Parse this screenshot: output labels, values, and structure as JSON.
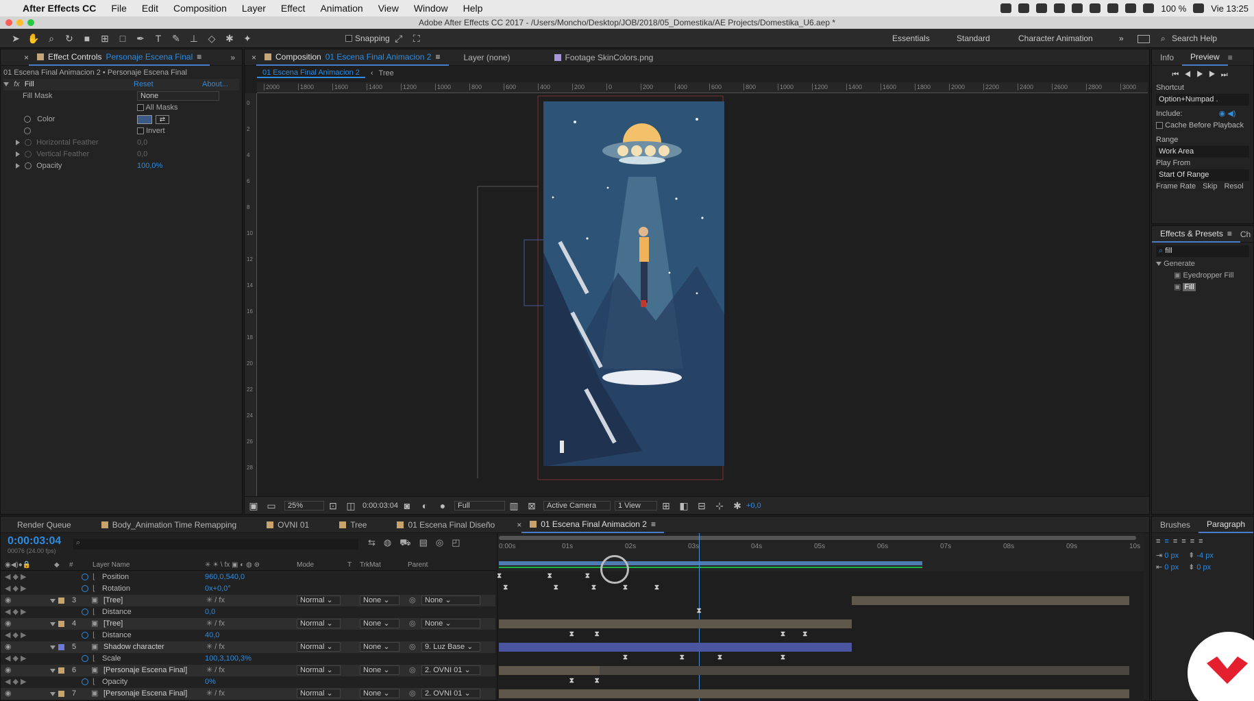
{
  "menubar": {
    "app": "After Effects CC",
    "items": [
      "File",
      "Edit",
      "Composition",
      "Layer",
      "Effect",
      "Animation",
      "View",
      "Window",
      "Help"
    ],
    "battery": "100 %",
    "clock": "Vie 13:25"
  },
  "window_title": "Adobe After Effects CC 2017 - /Users/Moncho/Desktop/JOB/2018/05_Domestika/AE Projects/Domestika_U6.aep *",
  "toolbar": {
    "snapping_label": "Snapping",
    "workspaces": [
      "Essentials",
      "Standard",
      "Character Animation"
    ],
    "search_help": "Search Help"
  },
  "effect_controls": {
    "tab_prefix": "Effect Controls",
    "tab_layer": "Personaje Escena Final",
    "breadcrumb": "01 Escena Final Animacion 2 • Personaje Escena Final",
    "effect_name": "Fill",
    "reset": "Reset",
    "about": "About...",
    "fill_mask_label": "Fill Mask",
    "fill_mask_value": "None",
    "all_masks": "All Masks",
    "color_label": "Color",
    "invert": "Invert",
    "h_feather_label": "Horizontal Feather",
    "h_feather_value": "0,0",
    "v_feather_label": "Vertical Feather",
    "v_feather_value": "0,0",
    "opacity_label": "Opacity",
    "opacity_value": "100,0%",
    "fill_color": "#3b5b86"
  },
  "composition": {
    "tab_prefix": "Composition",
    "tab_name": "01 Escena Final Animacion 2",
    "layer_tab": "Layer (none)",
    "footage_tab": "Footage SkinColors.png",
    "nav_current": "01 Escena Final Animacion 2",
    "nav_next": "Tree",
    "ruler_labels": [
      "2000",
      "1800",
      "1600",
      "1400",
      "1200",
      "1000",
      "800",
      "600",
      "400",
      "200",
      "0",
      "200",
      "400",
      "600",
      "800",
      "1000",
      "1200",
      "1400",
      "1600",
      "1800",
      "2000",
      "2200",
      "2400",
      "2600",
      "2800",
      "3000"
    ],
    "vruler_labels": [
      "0",
      "2",
      "4",
      "6",
      "8",
      "10",
      "12",
      "14",
      "16",
      "18",
      "20",
      "22",
      "24",
      "26",
      "28"
    ],
    "zoom": "25%",
    "timecode": "0:00:03:04",
    "resolution": "Full",
    "camera": "Active Camera",
    "views": "1 View",
    "exposure": "+0,0"
  },
  "info_preview": {
    "tab_info": "Info",
    "tab_preview": "Preview",
    "shortcut_label": "Shortcut",
    "shortcut_value": "Option+Numpad .",
    "include_label": "Include:",
    "cache_label": "Cache Before Playback",
    "range_label": "Range",
    "range_value": "Work Area",
    "play_from_label": "Play From",
    "play_from_value": "Start Of Range",
    "frame_rate": "Frame Rate",
    "skip": "Skip",
    "resolution": "Resol"
  },
  "effects_presets": {
    "tab": "Effects & Presets",
    "tab2": "Ch",
    "search_value": "fill",
    "category": "Generate",
    "items": [
      "Eyedropper Fill",
      "Fill"
    ]
  },
  "timeline_tabs": [
    "Render Queue",
    "Body_Animation Time Remapping",
    "OVNI 01",
    "Tree",
    "01 Escena Final Diseño",
    "01 Escena Final Animacion 2"
  ],
  "timeline": {
    "timecode": "0:00:03:04",
    "frames": "00076 (24.00 fps)",
    "col_layer_name": "Layer Name",
    "col_mode": "Mode",
    "col_t": "T",
    "col_trkmat": "TrkMat",
    "col_parent": "Parent",
    "time_labels": [
      "0:00s",
      "01s",
      "02s",
      "03s",
      "04s",
      "05s",
      "06s",
      "07s",
      "08s",
      "09s",
      "10s"
    ],
    "rows": [
      {
        "num": "",
        "name": "Position",
        "value": "960,0,540,0",
        "prop": true
      },
      {
        "num": "",
        "name": "Rotation",
        "value": "0x+0,0°",
        "prop": true
      },
      {
        "num": "3",
        "name": "[Tree]",
        "mode": "Normal",
        "trkmat": "None",
        "parent": "None",
        "prop": false
      },
      {
        "num": "",
        "name": "Distance",
        "value": "0,0",
        "prop": true
      },
      {
        "num": "4",
        "name": "[Tree]",
        "mode": "Normal",
        "trkmat": "None",
        "parent": "None",
        "prop": false
      },
      {
        "num": "",
        "name": "Distance",
        "value": "40,0",
        "prop": true
      },
      {
        "num": "5",
        "name": "Shadow character",
        "mode": "Normal",
        "trkmat": "None",
        "parent": "9. Luz Base",
        "prop": false
      },
      {
        "num": "",
        "name": "Scale",
        "value": "100,3,100,3%",
        "prop": true
      },
      {
        "num": "6",
        "name": "[Personaje Escena Final]",
        "mode": "Normal",
        "trkmat": "None",
        "parent": "2. OVNI 01",
        "prop": false
      },
      {
        "num": "",
        "name": "Opacity",
        "value": "0%",
        "prop": true
      },
      {
        "num": "7",
        "name": "[Personaje Escena Final]",
        "mode": "Normal",
        "trkmat": "None",
        "parent": "2. OVNI 01",
        "prop": false
      }
    ]
  },
  "brushes_paragraph": {
    "tab_brushes": "Brushes",
    "tab_paragraph": "Paragraph",
    "indent_left": "0 px",
    "indent_first": "0 px",
    "space_before": "-4 px",
    "space_after": "0 px"
  },
  "colors": {
    "accent": "#2e8ce0",
    "playhead": "#4a90d9",
    "sky": "#2d5476",
    "ufo_dome": "#f4c06a",
    "shadow_bar": "#4b55a0",
    "layer_bar": "#5e574a"
  }
}
